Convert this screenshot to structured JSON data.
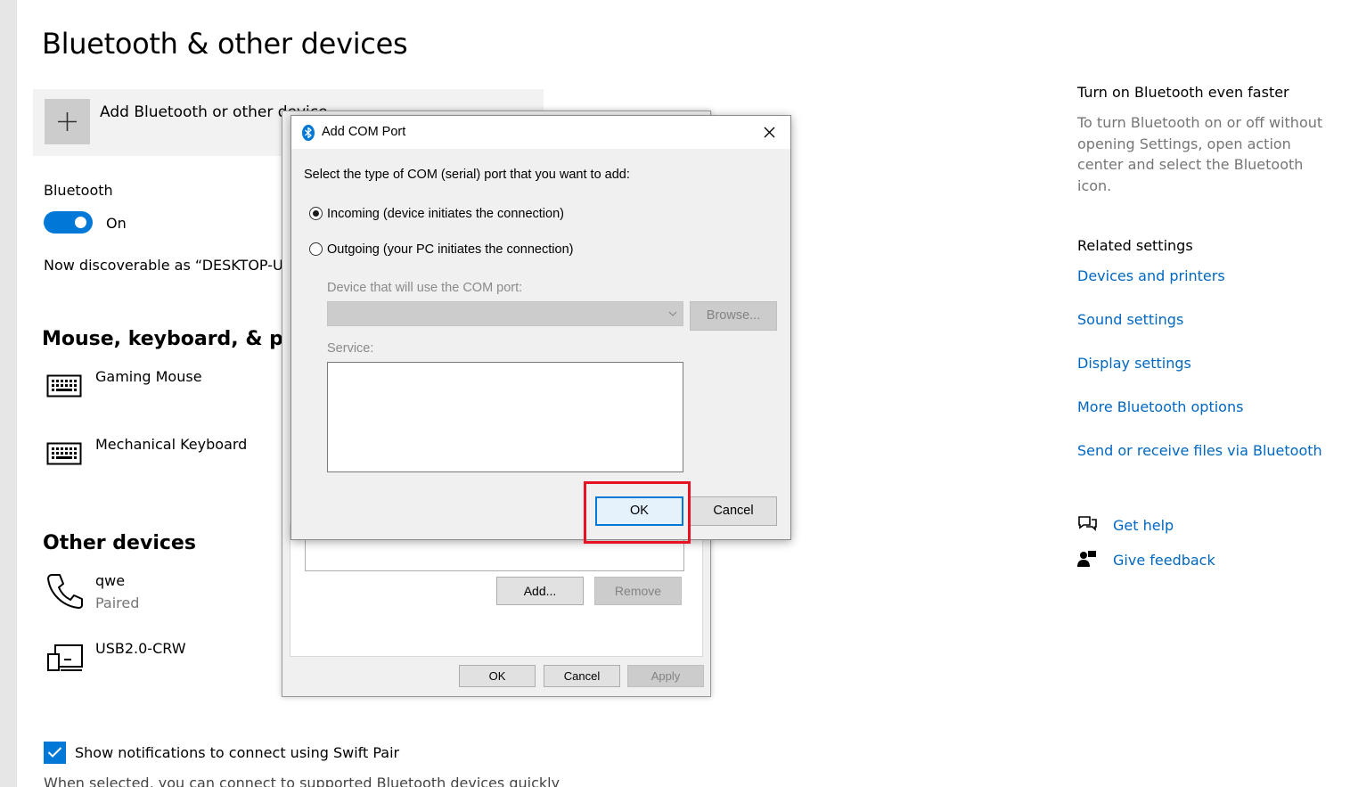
{
  "settings": {
    "title": "Bluetooth & other devices",
    "add_device_label": "Add Bluetooth or other device",
    "bluetooth_label": "Bluetooth",
    "bluetooth_state": "On",
    "discoverable_text": "Now discoverable as “DESKTOP-UE",
    "section_mouse": "Mouse, keyboard, & pen",
    "devices_mouse": [
      {
        "name": "Gaming Mouse",
        "icon": "keyboard-icon"
      },
      {
        "name": "Mechanical Keyboard",
        "icon": "keyboard-icon"
      }
    ],
    "section_other": "Other devices",
    "devices_other": [
      {
        "name": "qwe",
        "status": "Paired",
        "icon": "phone-icon"
      },
      {
        "name": "USB2.0-CRW",
        "icon": "device-icon"
      }
    ],
    "swift_pair_label": "Show notifications to connect using Swift Pair",
    "swift_pair_checked": true,
    "swift_pair_desc": "When selected, you can connect to supported Bluetooth devices quickly"
  },
  "right_column": {
    "faster_heading": "Turn on Bluetooth even faster",
    "faster_body": "To turn Bluetooth on or off without opening Settings, open action center and select the Bluetooth icon.",
    "related_heading": "Related settings",
    "links": [
      "Devices and printers",
      "Sound settings",
      "Display settings",
      "More Bluetooth options",
      "Send or receive files via Bluetooth"
    ],
    "help": {
      "get_help": "Get help",
      "give_feedback": "Give feedback"
    }
  },
  "bg_dialog": {
    "add_button": "Add...",
    "remove_button": "Remove",
    "ok_button": "OK",
    "cancel_button": "Cancel",
    "apply_button": "Apply"
  },
  "com_dialog": {
    "title": "Add COM Port",
    "prompt": "Select the type of COM (serial) port that you want to add:",
    "option_incoming": "Incoming (device initiates the connection)",
    "option_outgoing": "Outgoing (your PC initiates the connection)",
    "selected_option": "incoming",
    "device_label": "Device that will use the COM port:",
    "device_value": "",
    "browse_button": "Browse...",
    "service_label": "Service:",
    "ok_button": "OK",
    "cancel_button": "Cancel"
  },
  "colors": {
    "accent": "#0078d7",
    "link": "#0067c0",
    "highlight": "#e81123"
  }
}
